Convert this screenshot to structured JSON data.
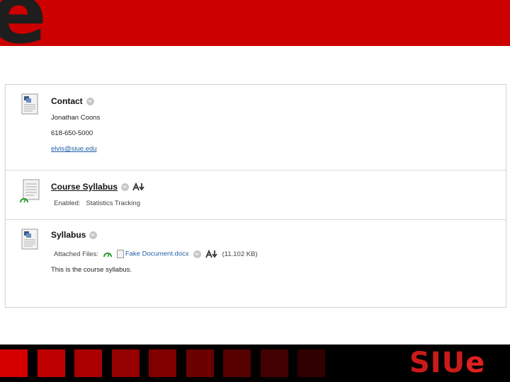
{
  "header": {
    "logo_letter": "e"
  },
  "items": [
    {
      "title": "Contact",
      "lines": [
        "Jonathan Coons",
        "618-650-5000"
      ],
      "email": "elvis@siue.edu"
    },
    {
      "title": "Course Syllabus",
      "enabled_label": "Enabled:",
      "enabled_value": "Statistics Tracking"
    },
    {
      "title": "Syllabus",
      "attached_label": "Attached Files:",
      "file_name": "Fake Document.docx",
      "file_size": "(11.102 KB)",
      "description": "This is the course syllabus."
    }
  ],
  "footer": {
    "brand": "SIU",
    "brand_mark": "e",
    "square_colors": [
      "#d40000",
      "#bf0000",
      "#aa0000",
      "#950000",
      "#800000",
      "#6b0000",
      "#560000",
      "#430000",
      "#300000"
    ]
  }
}
